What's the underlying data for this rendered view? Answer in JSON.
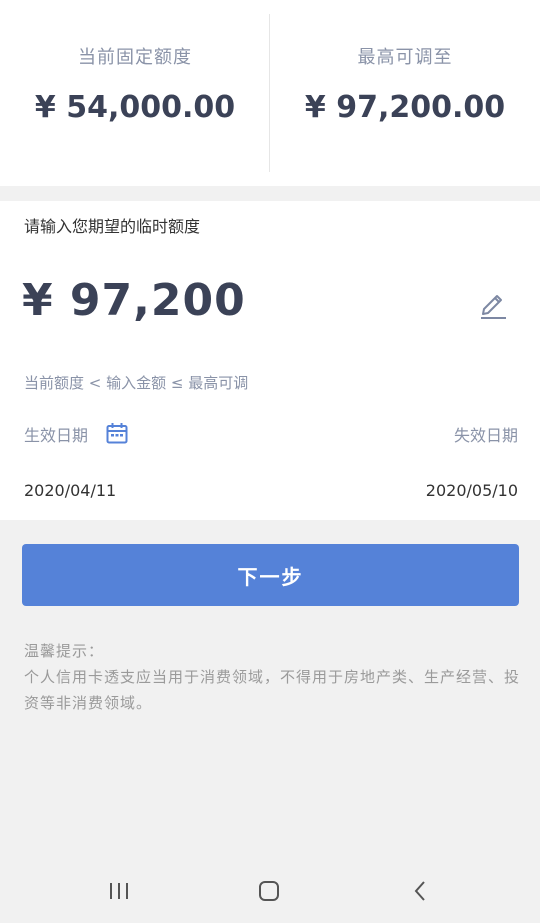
{
  "limits": {
    "current": {
      "label": "当前固定额度",
      "value": "¥ 54,000.00"
    },
    "max": {
      "label": "最高可调至",
      "value": "¥ 97,200.00"
    }
  },
  "form": {
    "title": "请输入您期望的临时额度",
    "amount": "¥ 97,200",
    "hint": "当前额度 < 输入金额 ≤ 最高可调",
    "start_label": "生效日期",
    "end_label": "失效日期",
    "start_date": "2020/04/11",
    "end_date": "2020/05/10"
  },
  "next_button": {
    "label": "下一步"
  },
  "tips": {
    "title": "温馨提示：",
    "text": "个人信用卡透支应当用于消费领域，不得用于房地产类、生产经营、投资等非消费领域。"
  },
  "icons": {
    "edit": "edit-pencil-icon",
    "calendar": "calendar-icon",
    "recents": "recents-icon",
    "home": "home-icon",
    "back": "back-icon"
  },
  "colors": {
    "accent": "#5582d8",
    "amount_text": "#3b4257",
    "muted_text": "#8a93a8",
    "background": "#f1f1f1"
  }
}
